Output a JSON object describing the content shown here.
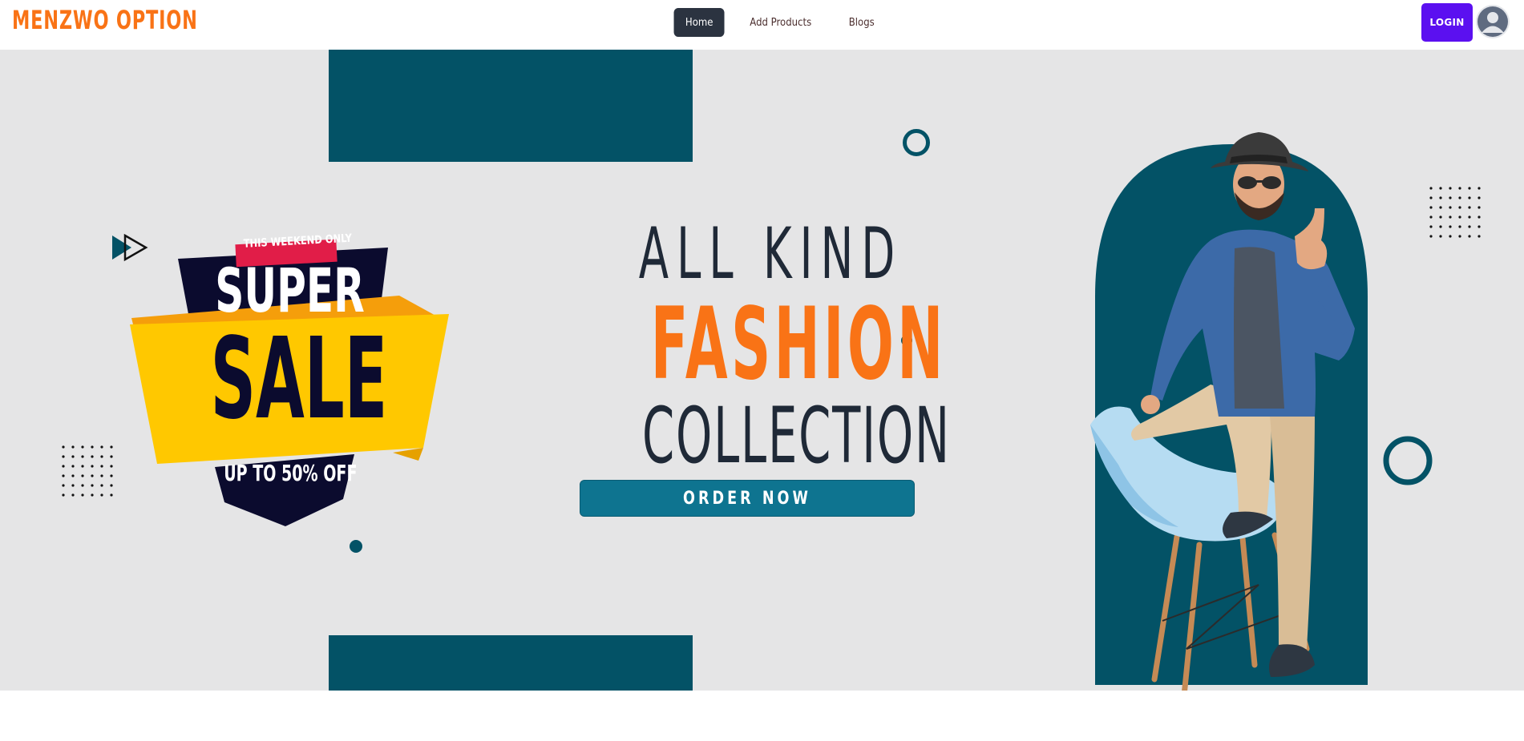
{
  "navbar": {
    "brand": "MENZWO OPTION",
    "items": [
      {
        "label": "Home",
        "active": true
      },
      {
        "label": "Add Products",
        "active": false
      },
      {
        "label": "Blogs",
        "active": false
      }
    ],
    "login_label": "LOGIN",
    "avatar_icon": "user-avatar-icon"
  },
  "hero": {
    "sale_badge": {
      "top_ribbon": "THIS WEEKEND ONLY",
      "line1": "SUPER",
      "line2": "SALE",
      "line3": "UP TO 50% OFF"
    },
    "headline": {
      "line1": "ALL KIND",
      "line2": "FASHION",
      "line3": "COLLECTION"
    },
    "cta_label": "ORDER NOW",
    "colors": {
      "accent_orange": "#f97316",
      "teal": "#035266",
      "button_teal": "#0e7490",
      "login_purple": "#5b10f0",
      "sale_yellow": "#ffc800",
      "sale_navy": "#0b0b2e",
      "ribbon_red": "#e11d48"
    }
  }
}
